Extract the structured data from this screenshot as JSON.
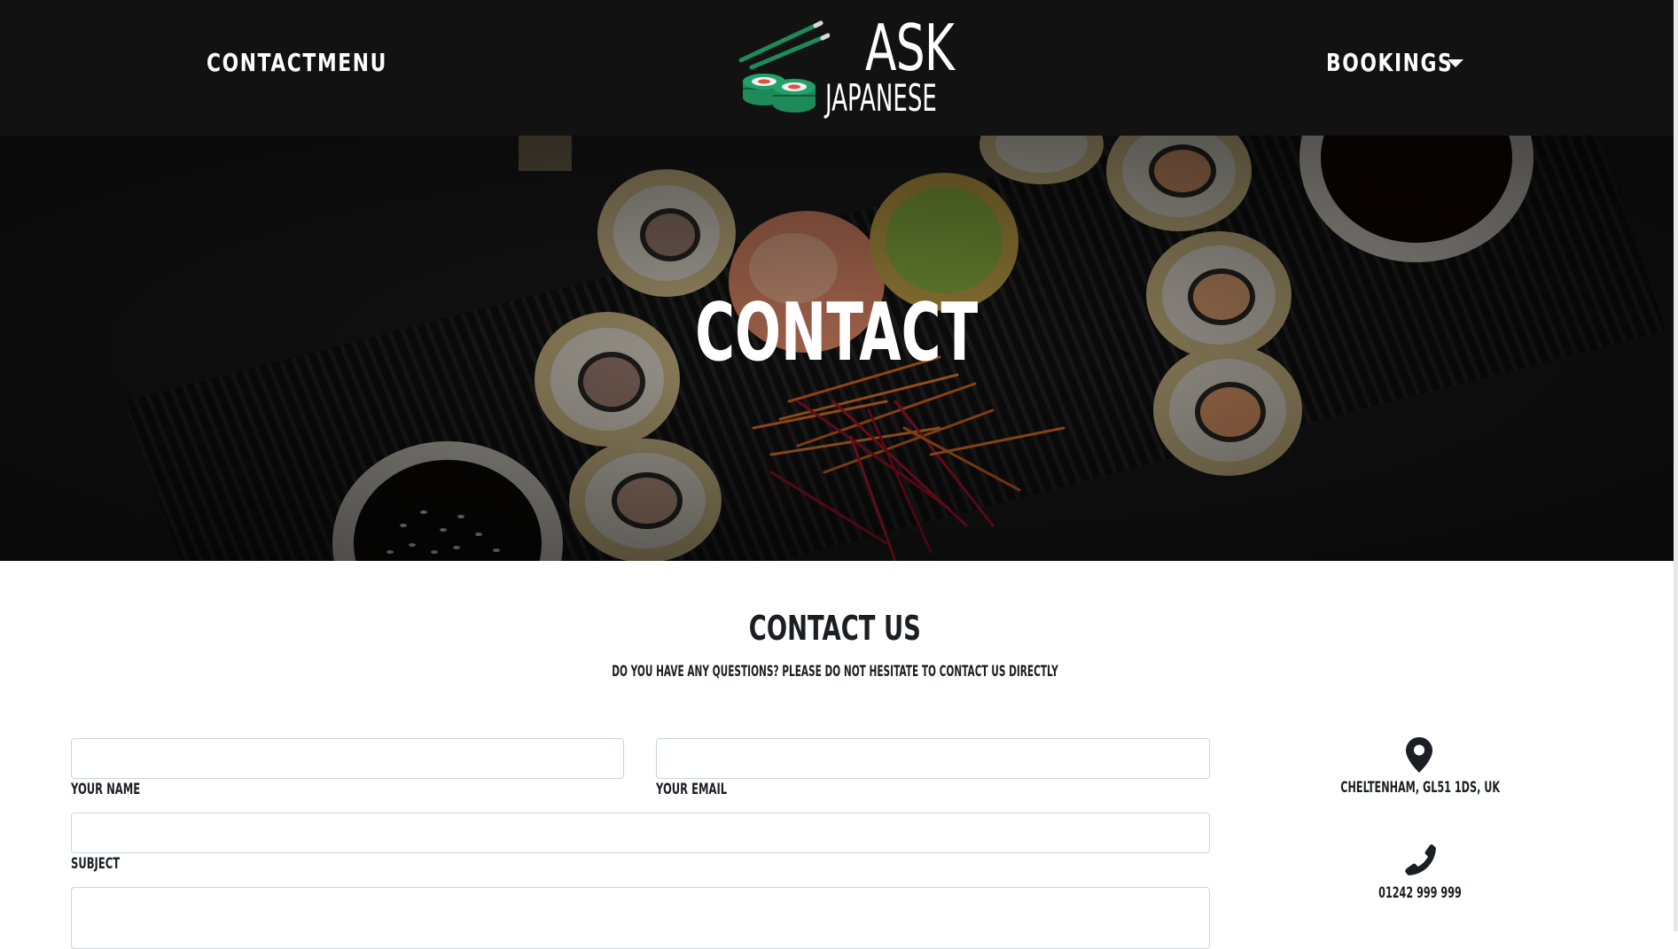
{
  "nav": {
    "left_links": [
      {
        "label": "CONTACT"
      },
      {
        "label": "MENU"
      }
    ],
    "right_dropdown": {
      "label": "BOOKINGS"
    }
  },
  "logo": {
    "line1": "ASK",
    "line2": "JAPANESE",
    "icon": "sushi-chopsticks-logo",
    "brand_color": "#1e8a5a"
  },
  "hero": {
    "title": "CONTACT"
  },
  "contact_section": {
    "title": "CONTACT US",
    "subtitle": "DO YOU HAVE ANY QUESTIONS? PLEASE DO NOT HESITATE TO CONTACT US DIRECTLY"
  },
  "form": {
    "name": {
      "label": "YOUR NAME",
      "value": ""
    },
    "email": {
      "label": "YOUR EMAIL",
      "value": ""
    },
    "subject": {
      "label": "SUBJECT",
      "value": ""
    },
    "message": {
      "value": ""
    }
  },
  "info": {
    "address": {
      "icon": "map-pin-icon",
      "text": "CHELTENHAM, GL51 1DS, UK"
    },
    "phone": {
      "icon": "phone-icon",
      "text": "01242 999 999"
    }
  },
  "colors": {
    "navbar_bg": "#121212",
    "text_dark": "#1b1f24"
  }
}
